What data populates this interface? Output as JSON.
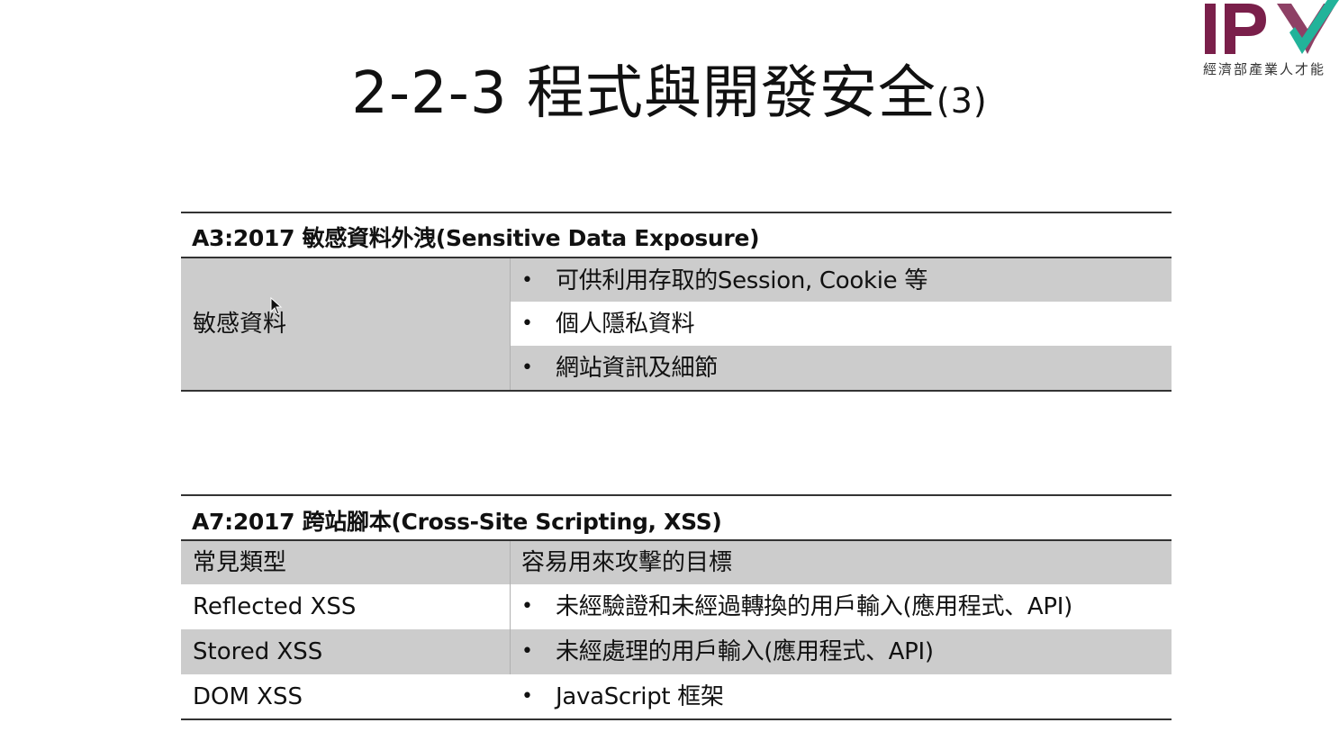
{
  "title": {
    "main": "2-2-3 程式與開發安全",
    "suffix": "(3)"
  },
  "logo": {
    "text": "IPA",
    "subtitle": "經濟部產業人才能"
  },
  "table_a3": {
    "header": "A3:2017 敏感資料外洩(Sensitive Data Exposure)",
    "left_label": "敏感資料",
    "items": [
      "可供利用存取的Session, Cookie 等",
      "個人隱私資料",
      "網站資訊及細節"
    ]
  },
  "table_a7": {
    "header": "A7:2017 跨站腳本(Cross-Site Scripting, XSS)",
    "col_headers": [
      "常見類型",
      "容易用來攻擊的目標"
    ],
    "rows": [
      {
        "type": "Reflected XSS",
        "target": "未經驗證和未經過轉換的用戶輸入(應用程式、API)"
      },
      {
        "type": "Stored XSS",
        "target": "未經處理的用戶輸入(應用程式、API)"
      },
      {
        "type": "DOM XSS",
        "target": "JavaScript 框架"
      }
    ]
  },
  "bullet_char": "•",
  "colors": {
    "logo_primary": "#7a1f4a",
    "logo_accent": "#22b39a",
    "row_gray": "#cccccc",
    "rule": "#333333"
  }
}
